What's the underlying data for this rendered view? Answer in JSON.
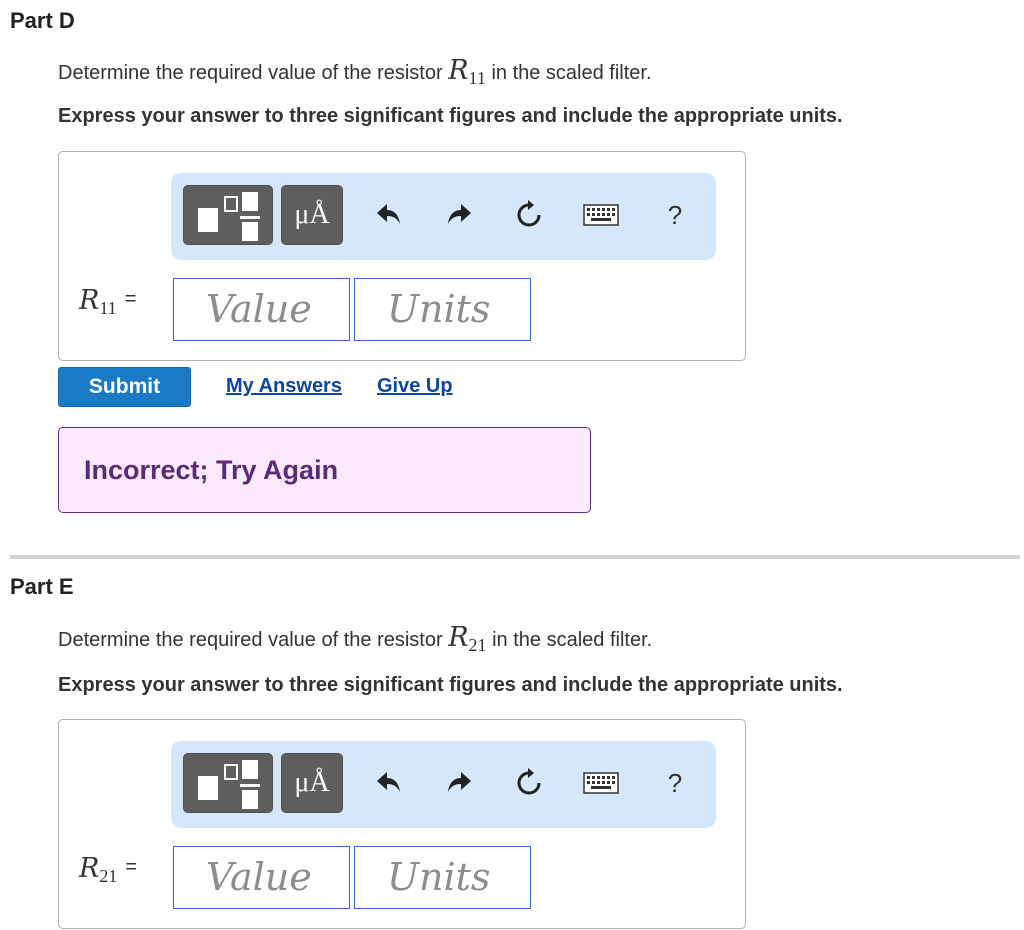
{
  "part_d": {
    "title": "Part D",
    "question_before": "Determine the required value of the resistor",
    "variable_letter": "R",
    "variable_sub": "11",
    "question_after": "in the scaled filter.",
    "instruction": "Express your answer to three significant figures and include the appropriate units.",
    "toolbar": {
      "units_label": "μÅ",
      "icons": [
        "templates-icon",
        "units-icon",
        "undo-icon",
        "redo-icon",
        "reset-icon",
        "keyboard-icon",
        "help-icon"
      ],
      "help_label": "?"
    },
    "equals": "=",
    "value_placeholder": "Value",
    "units_placeholder": "Units",
    "submit_label": "Submit",
    "my_answers_label": "My Answers",
    "give_up_label": "Give Up",
    "feedback": "Incorrect; Try Again"
  },
  "part_e": {
    "title": "Part E",
    "question_before": "Determine the required value of the resistor",
    "variable_letter": "R",
    "variable_sub": "21",
    "question_after": "in the scaled filter.",
    "instruction": "Express your answer to three significant figures and include the appropriate units.",
    "toolbar": {
      "units_label": "μÅ",
      "help_label": "?"
    },
    "equals": "=",
    "value_placeholder": "Value",
    "units_placeholder": "Units"
  },
  "colors": {
    "toolbar_bg": "#d7e7fb",
    "button_dark": "#5e5e5e",
    "input_border": "#2d68c8",
    "submit_bg": "#1a7ac6",
    "link": "#0d47a1",
    "feedback_bg": "#fbe9fd",
    "feedback_border": "#6b2f86"
  }
}
